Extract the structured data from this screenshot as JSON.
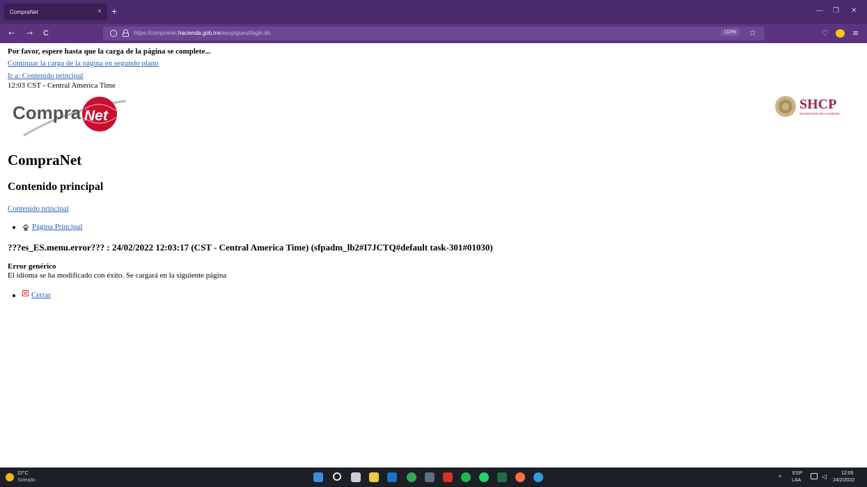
{
  "browser": {
    "tab_title": "CompraNet",
    "tab_close": "×",
    "new_tab": "+",
    "url_prefix": "https://compranet.",
    "url_domain": "hacienda.gob.mx",
    "url_path": "/esop/guest/login.do",
    "zoom": "110%",
    "back_icon": "←",
    "forward_icon": "→",
    "reload_icon": "C",
    "star_icon": "☆",
    "minimize": "—",
    "restore": "❐",
    "close": "✕",
    "pocket_icon": "♡",
    "menu_icon": "≡"
  },
  "page": {
    "loading_message": "Por favor, espere hasta que la carga de la página se complete...",
    "continue_link": "Continuar la carga de la página en segundo plano",
    "skip_link": "Ir a: Contenido principal",
    "time": "12:03 CST - Central America Time",
    "logo_left_text_a": "Compra",
    "logo_left_text_b": "Net",
    "logo_right_text": "SHCP",
    "logo_right_sub": "SECRETARÍA DE HACIENDA",
    "site_title": "CompraNet",
    "section_title": "Contenido principal",
    "main_link": "Contenido principal",
    "home_link": "Página Principal",
    "error_line": "???es_ES.menu.error??? : 24/02/2022 12:03:17 (CST - Central America Time) (sfpadm_lb2#I7JCTQ#default task-301#01030)",
    "error_title": "Error genérico",
    "error_message": "El idioma se ha modificado con éxito. Se cargará en la siguiente página",
    "close_link": "Cerrar"
  },
  "taskbar": {
    "weather_temp": "22°C",
    "weather_desc": "Soleado",
    "language_top": "ESP",
    "language_bottom": "LAA",
    "time": "12:05",
    "date": "24/2/2022",
    "apps": [
      "windows-start",
      "search",
      "task-view",
      "file-explorer",
      "outlook",
      "chrome",
      "calculator",
      "acrobat",
      "spotify",
      "whatsapp",
      "excel",
      "firefox",
      "edge"
    ],
    "colors": {
      "windows": "#3a8ee6",
      "search": "#e8e8e8",
      "taskview": "#d0d0d0",
      "explorer": "#f3c63f",
      "outlook": "#1a73c9",
      "chrome": "#34a853",
      "calculator": "#5b6f86",
      "acrobat": "#d93025",
      "spotify": "#1db954",
      "whatsapp": "#25d366",
      "excel": "#1d7044",
      "firefox": "#ff7139",
      "edge": "#2f9be0"
    }
  },
  "colors": {
    "tabbar": "#4b2a6b",
    "navbar": "#5b3480",
    "link": "#2a5db0",
    "compranet_red": "#c8102e",
    "shcp_maroon": "#9d2449"
  }
}
